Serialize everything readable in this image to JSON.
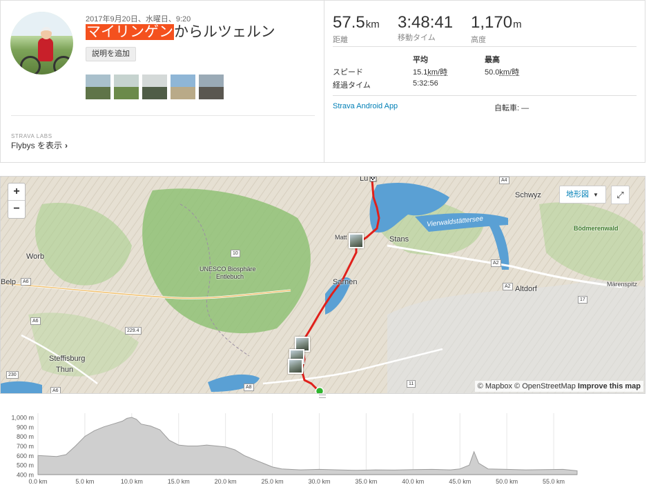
{
  "activity": {
    "date": "2017年9月20日、水曜日、9:20",
    "title_highlight": "マイリンゲン",
    "title_rest": "からルツェルン",
    "add_description": "説明を追加",
    "photo_count": 5
  },
  "labs": {
    "label": "STRAVA LABS",
    "flybys": "Flybys を表示",
    "chevron": "›"
  },
  "stats": {
    "distance": {
      "value": "57.5",
      "unit": "km",
      "label": "距離"
    },
    "moving_time": {
      "value": "3:48:41",
      "label": "移動タイム"
    },
    "elevation": {
      "value": "1,170",
      "unit": "m",
      "label": "高度"
    }
  },
  "stats_table": {
    "col_avg": "平均",
    "col_max": "最高",
    "rows": [
      {
        "label": "スピード",
        "avg": "15.1",
        "avg_unit": "km/時",
        "max": "50.0",
        "max_unit": "km/時"
      },
      {
        "label": "経過タイム",
        "avg": "5:32:56",
        "avg_unit": "",
        "max": "",
        "max_unit": ""
      }
    ]
  },
  "device": {
    "app": "Strava Android App",
    "bike_label": "自転車:",
    "bike_value": "—"
  },
  "map": {
    "zoom_in": "+",
    "zoom_out": "−",
    "map_type": "地形図",
    "map_type_caret": "▼",
    "fullscreen": "⤢",
    "attribution_mapbox": "© Mapbox",
    "attribution_osm": "© OpenStreetMap",
    "attribution_improve": "Improve this map",
    "places": {
      "luzern": "Lu",
      "schwyz": "Schwyz",
      "stans": "Stans",
      "worb": "Worb",
      "belp": "Belp",
      "sarnen": "Sarnen",
      "altdorf": "Altdorf",
      "steffisburg": "Steffisburg",
      "thun": "Thun",
      "matt": "Matt",
      "unesco1": "UNESCO Biosphäre",
      "unesco2": "Entlebuch",
      "lake": "Vierwaldstättersee",
      "bodmerenwald": "Bödmerenwald",
      "marenspitz": "Märenspitz"
    },
    "roads": {
      "a4": "A4",
      "a2a": "A2",
      "a2b": "A2",
      "a6a": "A6",
      "a6b": "A6",
      "a6c": "A6",
      "a8": "A8",
      "r10": "10",
      "r17": "17",
      "r11": "11",
      "r2294": "229.4",
      "r230": "230"
    },
    "colors": {
      "route": "#e0201b",
      "water": "#5aa0d4",
      "forest": "#8fc176",
      "terrain": "#e6e0d3"
    }
  },
  "elevation_chart": {
    "y_ticks": [
      "1,000 m",
      "900 m",
      "800 m",
      "700 m",
      "600 m",
      "500 m",
      "400 m"
    ],
    "x_ticks": [
      "0.0 km",
      "5.0 km",
      "10.0 km",
      "15.0 km",
      "20.0 km",
      "25.0 km",
      "30.0 km",
      "35.0 km",
      "40.0 km",
      "45.0 km",
      "50.0 km",
      "55.0 km"
    ]
  },
  "chart_data": {
    "type": "area",
    "title": "",
    "xlabel": "",
    "ylabel": "",
    "xlim": [
      0,
      57.5
    ],
    "ylim": [
      400,
      1000
    ],
    "x": [
      0,
      1,
      2,
      3,
      4,
      5,
      6,
      7,
      8,
      9,
      9.5,
      10,
      10.5,
      11,
      12,
      13,
      14,
      15,
      16,
      17,
      18,
      19,
      20,
      21,
      22,
      23,
      24,
      25,
      26,
      28,
      30,
      32,
      34,
      36,
      38,
      40,
      42,
      44,
      45,
      46,
      46.5,
      47,
      48,
      50,
      52,
      54,
      56,
      57.5
    ],
    "y": [
      600,
      595,
      590,
      610,
      700,
      800,
      860,
      900,
      930,
      960,
      990,
      1000,
      980,
      930,
      910,
      870,
      760,
      710,
      700,
      700,
      710,
      700,
      690,
      660,
      600,
      560,
      520,
      480,
      460,
      450,
      455,
      450,
      445,
      450,
      448,
      452,
      455,
      450,
      460,
      500,
      640,
      520,
      460,
      455,
      450,
      452,
      455,
      440
    ]
  }
}
